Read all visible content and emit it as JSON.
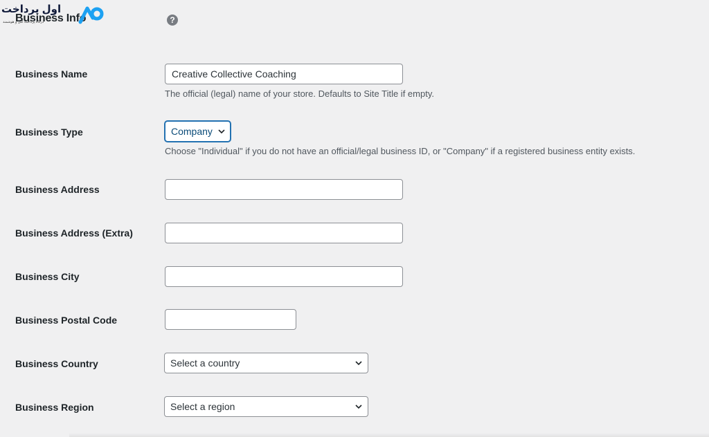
{
  "logo": {
    "persian_text": "اول پرداخت",
    "wordmark": "Business Info",
    "tagline": "درگاه پرداخت امن و هوشمند",
    "brand_color": "#1da1f2"
  },
  "help_icon": {
    "glyph": "?"
  },
  "fields": {
    "business_name": {
      "label": "Business Name",
      "value": "Creative Collective Coaching",
      "description": "The official (legal) name of your store. Defaults to Site Title if empty."
    },
    "business_type": {
      "label": "Business Type",
      "selected": "Company",
      "description": "Choose \"Individual\" if you do not have an official/legal business ID, or \"Company\" if a registered business entity exists."
    },
    "business_address": {
      "label": "Business Address",
      "value": ""
    },
    "business_address_extra": {
      "label": "Business Address (Extra)",
      "value": ""
    },
    "business_city": {
      "label": "Business City",
      "value": ""
    },
    "business_postal_code": {
      "label": "Business Postal Code",
      "value": ""
    },
    "business_country": {
      "label": "Business Country",
      "selected": "Select a country"
    },
    "business_region": {
      "label": "Business Region",
      "selected": "Select a region"
    }
  }
}
